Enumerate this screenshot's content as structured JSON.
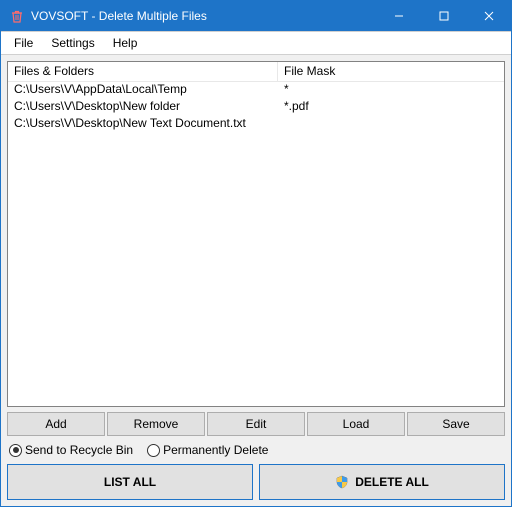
{
  "window": {
    "title": "VOVSOFT - Delete Multiple Files"
  },
  "menu": {
    "file": "File",
    "settings": "Settings",
    "help": "Help"
  },
  "list": {
    "head_files": "Files & Folders",
    "head_mask": "File Mask",
    "rows": [
      {
        "path": "C:\\Users\\V\\AppData\\Local\\Temp",
        "mask": "*"
      },
      {
        "path": "C:\\Users\\V\\Desktop\\New folder",
        "mask": "*.pdf"
      },
      {
        "path": "C:\\Users\\V\\Desktop\\New Text Document.txt",
        "mask": ""
      }
    ]
  },
  "buttons": {
    "add": "Add",
    "remove": "Remove",
    "edit": "Edit",
    "load": "Load",
    "save": "Save"
  },
  "radios": {
    "recycle": "Send to Recycle Bin",
    "permanent": "Permanently Delete",
    "selected": "recycle"
  },
  "bigbuttons": {
    "list_all": "LIST ALL",
    "delete_all": "DELETE ALL"
  }
}
